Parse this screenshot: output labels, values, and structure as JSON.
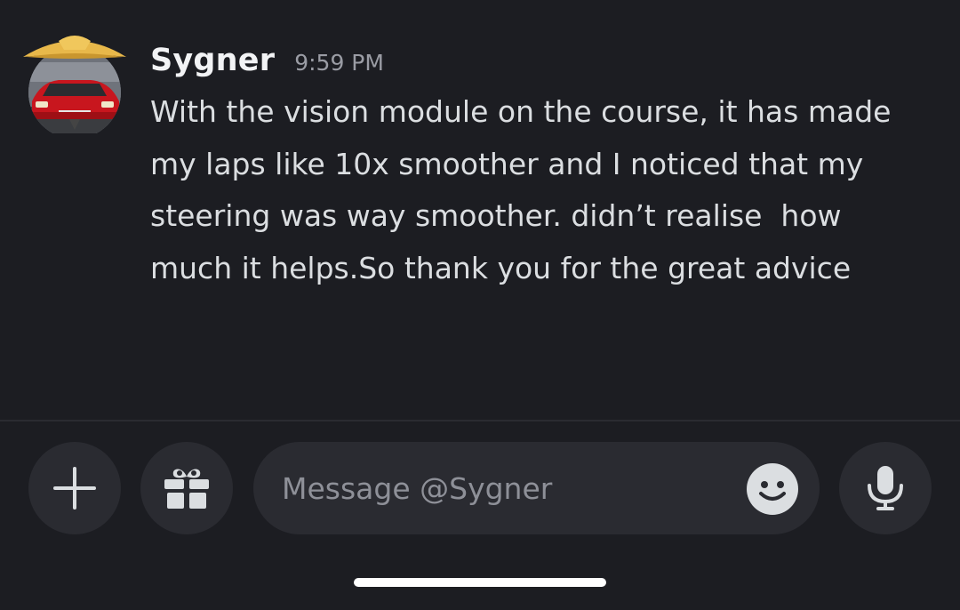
{
  "message": {
    "username": "Sygner",
    "timestamp": "9:59 PM",
    "text": "With the vision module on the course, it has made my laps like 10x smoother and I noticed that my steering was way smoother. didn’t realise  how much it helps.So thank you for the great advice",
    "avatar_icon": "avatar-red-car-with-straw-hat"
  },
  "composer": {
    "placeholder": "Message @Sygner",
    "value": "",
    "plus_icon": "plus-icon",
    "gift_icon": "gift-icon",
    "emoji_icon": "smiley-face-icon",
    "mic_icon": "microphone-icon"
  },
  "colors": {
    "background": "#1c1d22",
    "surface": "#2a2b31",
    "text_primary": "#f2f3f5",
    "text_body": "#dbdee1",
    "text_muted": "#9a9ca4"
  }
}
